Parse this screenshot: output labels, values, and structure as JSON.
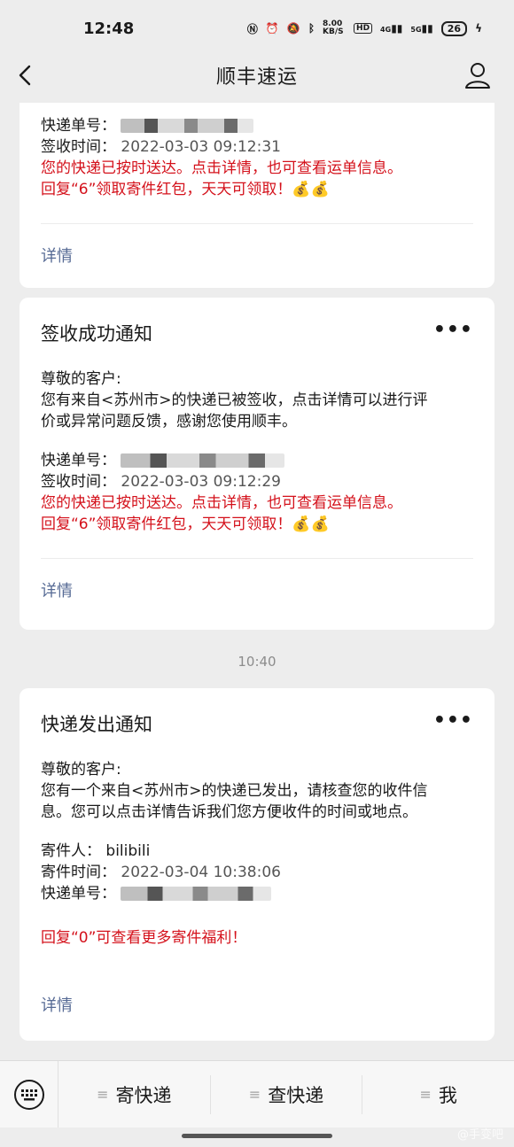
{
  "status_bar": {
    "time": "12:48",
    "icons": [
      "nfc-icon",
      "alarm-icon",
      "mute-icon",
      "bluetooth-icon",
      "network-speed-icon",
      "hd-icon",
      "signal-4g-icon",
      "signal-5g-icon",
      "battery-icon"
    ],
    "network_speed": "8.00 KB/S",
    "hd": "HD",
    "signal_4g": "4G",
    "signal_5g": "5G",
    "battery": "26"
  },
  "nav": {
    "title": "顺丰速运"
  },
  "cards": [
    {
      "tracking_label": "快递单号：",
      "time_label": "签收时间：",
      "time_value": "2022-03-03 09:12:31",
      "red_line_1": "您的快递已按时送达。点击详情，也可查看运单信息。",
      "red_line_2": "回复“6”领取寄件红包，天天可领取！💰💰",
      "detail": "详情"
    },
    {
      "title": "签收成功通知",
      "more": "•••",
      "greeting": "尊敬的客户:",
      "body_1": "您有来自<苏州市>的快递已被签收，点击详情可以进行评",
      "body_2": "价或异常问题反馈，感谢您使用顺丰。",
      "tracking_label": "快递单号：",
      "time_label": "签收时间：",
      "time_value": "2022-03-03 09:12:29",
      "red_line_1": "您的快递已按时送达。点击详情，也可查看运单信息。",
      "red_line_2": "回复“6”领取寄件红包，天天可领取！💰💰",
      "detail": "详情"
    },
    {
      "title": "快递发出通知",
      "more": "•••",
      "greeting": "尊敬的客户:",
      "body_1": "您有一个来自<苏州市>的快递已发出，请核查您的收件信",
      "body_2": "息。您可以点击详情告诉我们您方便收件的时间或地点。",
      "sender_label": "寄件人：",
      "sender_value": "bilibili",
      "send_time_label": "寄件时间：",
      "send_time_value": "2022-03-04 10:38:06",
      "tracking_label": "快递单号：",
      "red_line": "回复“0”可查看更多寄件福利！",
      "detail": "详情"
    }
  ],
  "timestamp": "10:40",
  "bottom_menu": {
    "items": [
      "寄快递",
      "查快递",
      "我"
    ]
  },
  "watermark": "@手变吧"
}
